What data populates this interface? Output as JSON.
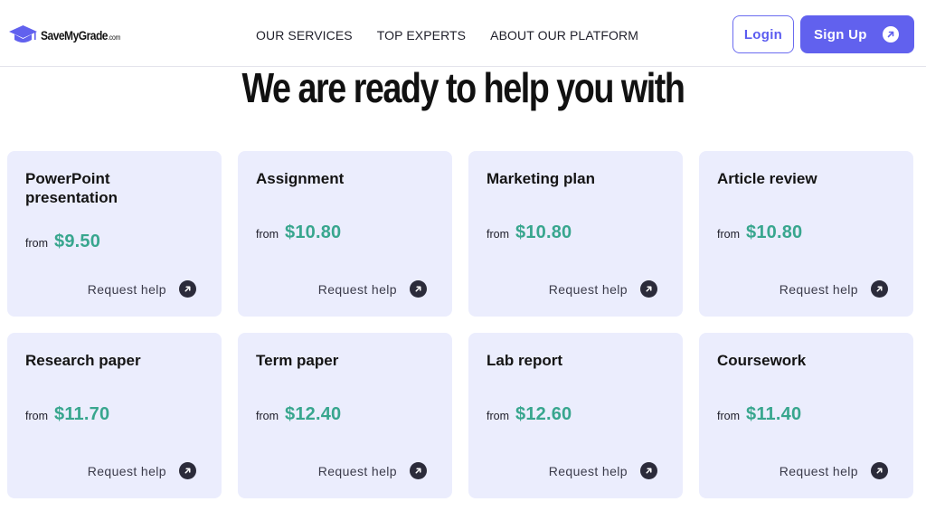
{
  "brand": {
    "name": "SaveMyGrade",
    "suffix": ".com",
    "accent": "#6161ee",
    "price_color": "#38a68e",
    "card_bg": "#ebedfd"
  },
  "nav": {
    "items": [
      "OUR SERVICES",
      "TOP EXPERTS",
      "ABOUT OUR PLATFORM"
    ]
  },
  "auth": {
    "login_label": "Login",
    "signup_label": "Sign Up"
  },
  "headline": "We are ready to help you with",
  "services": [
    {
      "title": "PowerPoint presentation",
      "from": "from",
      "price": "$9.50",
      "cta": "Request help"
    },
    {
      "title": "Assignment",
      "from": "from",
      "price": "$10.80",
      "cta": "Request help"
    },
    {
      "title": "Marketing plan",
      "from": "from",
      "price": "$10.80",
      "cta": "Request help"
    },
    {
      "title": "Article review",
      "from": "from",
      "price": "$10.80",
      "cta": "Request help"
    },
    {
      "title": "Research paper",
      "from": "from",
      "price": "$11.70",
      "cta": "Request help"
    },
    {
      "title": "Term paper",
      "from": "from",
      "price": "$12.40",
      "cta": "Request help"
    },
    {
      "title": "Lab report",
      "from": "from",
      "price": "$12.60",
      "cta": "Request help"
    },
    {
      "title": "Coursework",
      "from": "from",
      "price": "$11.40",
      "cta": "Request help"
    }
  ]
}
